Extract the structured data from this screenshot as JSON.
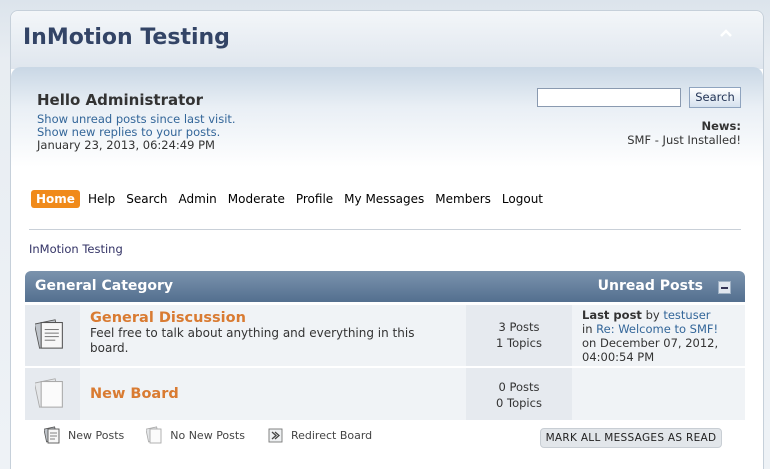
{
  "header": {
    "forum_title": "InMotion Testing"
  },
  "user": {
    "greeting": "Hello Administrator",
    "show_unread": "Show unread posts since last visit.",
    "show_replies": "Show new replies to your posts.",
    "date": "January 23, 2013, 06:24:49 PM"
  },
  "search": {
    "value": "",
    "button_label": "Search"
  },
  "news": {
    "label": "News:",
    "text": "SMF - Just Installed!"
  },
  "menu": {
    "items": [
      "Home",
      "Help",
      "Search",
      "Admin",
      "Moderate",
      "Profile",
      "My Messages",
      "Members",
      "Logout"
    ],
    "active": "Home"
  },
  "breadcrumb": "InMotion Testing",
  "category": {
    "title": "General Category",
    "unread_label": "Unread Posts",
    "boards": [
      {
        "name": "General Discussion",
        "description": "Feel free to talk about anything and everything in this board.",
        "posts": "3 Posts",
        "topics": "1 Topics",
        "last_post_label": "Last post",
        "last_post_by": "by",
        "last_post_user": "testuser",
        "last_post_in": "in",
        "last_post_topic": "Re: Welcome to SMF!",
        "last_post_date": "on December 07, 2012, 04:00:54 PM"
      },
      {
        "name": "New Board",
        "posts": "0 Posts",
        "topics": "0 Topics"
      }
    ]
  },
  "legend": {
    "new_posts": "New Posts",
    "no_new_posts": "No New Posts",
    "redirect_board": "Redirect Board"
  },
  "mark_read_label": "MARK ALL MESSAGES AS READ",
  "colors": {
    "accent": "#f08a1a",
    "link": "#336699",
    "board_name": "#d97b32",
    "header": "#536f8f"
  }
}
